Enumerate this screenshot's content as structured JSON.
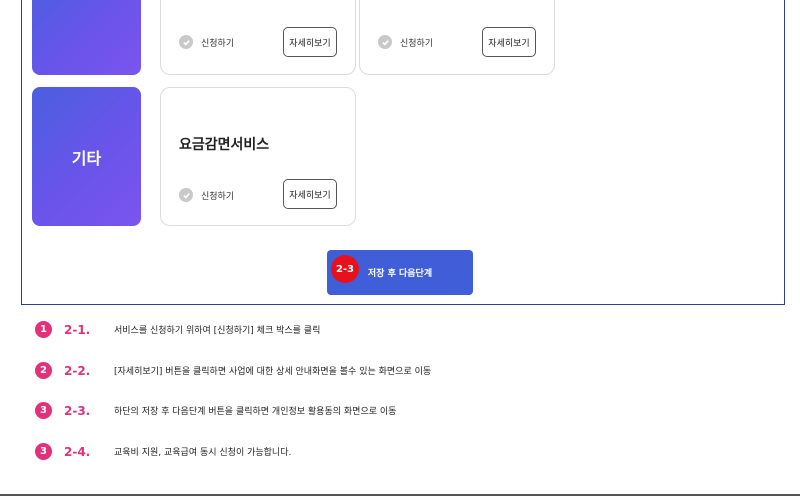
{
  "categories": [
    {
      "label": ""
    },
    {
      "label": "기타"
    }
  ],
  "cards": [
    {
      "title": "",
      "apply_label": "신청하기",
      "detail_label": "자세히보기"
    },
    {
      "title": "",
      "apply_label": "신청하기",
      "detail_label": "자세히보기"
    },
    {
      "title": "요금감면서비스",
      "apply_label": "신청하기",
      "detail_label": "자세히보기"
    }
  ],
  "save_button": {
    "label": "저장 후 다음단계",
    "badge": "2-3"
  },
  "steps": [
    {
      "circle": "1",
      "num": "2-1.",
      "text": "서비스를 신청하기 위하여 [신청하기] 체크 박스를 클릭"
    },
    {
      "circle": "2",
      "num": "2-2.",
      "text": "[자세히보기] 버튼을 클릭하면 사업에 대한 상세 안내화면을 볼수 있는 화면으로 이동"
    },
    {
      "circle": "3",
      "num": "2-3.",
      "text": "하단의 저장 후 다음단계 버튼을 클릭하면 개인정보 활용동의 화면으로 이동"
    },
    {
      "circle": "3",
      "num": "2-4.",
      "text": "교육비 지원, 교육급여 동시 신청이 가능합니다."
    }
  ],
  "colors": {
    "accent": "#3f5ed8",
    "step_pink": "#e0317a",
    "badge_red": "#e8101a"
  }
}
